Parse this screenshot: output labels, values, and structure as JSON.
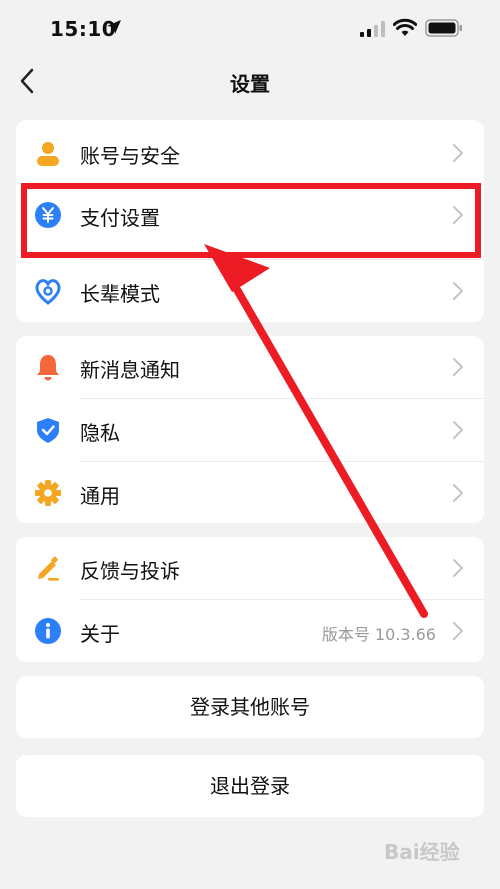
{
  "status_bar": {
    "time": "15:10"
  },
  "nav": {
    "title": "设置"
  },
  "group1": [
    {
      "label": "账号与安全"
    },
    {
      "label": "支付设置"
    },
    {
      "label": "长辈模式"
    }
  ],
  "group2": [
    {
      "label": "新消息通知"
    },
    {
      "label": "隐私"
    },
    {
      "label": "通用"
    }
  ],
  "group3": [
    {
      "label": "反馈与投诉"
    },
    {
      "label": "关于",
      "value": "版本号 10.3.66"
    }
  ],
  "buttons": {
    "switch_account": "登录其他账号",
    "logout": "退出登录"
  },
  "watermark": "Bai经验",
  "colors": {
    "annotation_red": "#ec1b24",
    "accent_blue": "#2d7ff9",
    "accent_orange": "#f5a623",
    "icon_red_orange": "#f5663d"
  }
}
